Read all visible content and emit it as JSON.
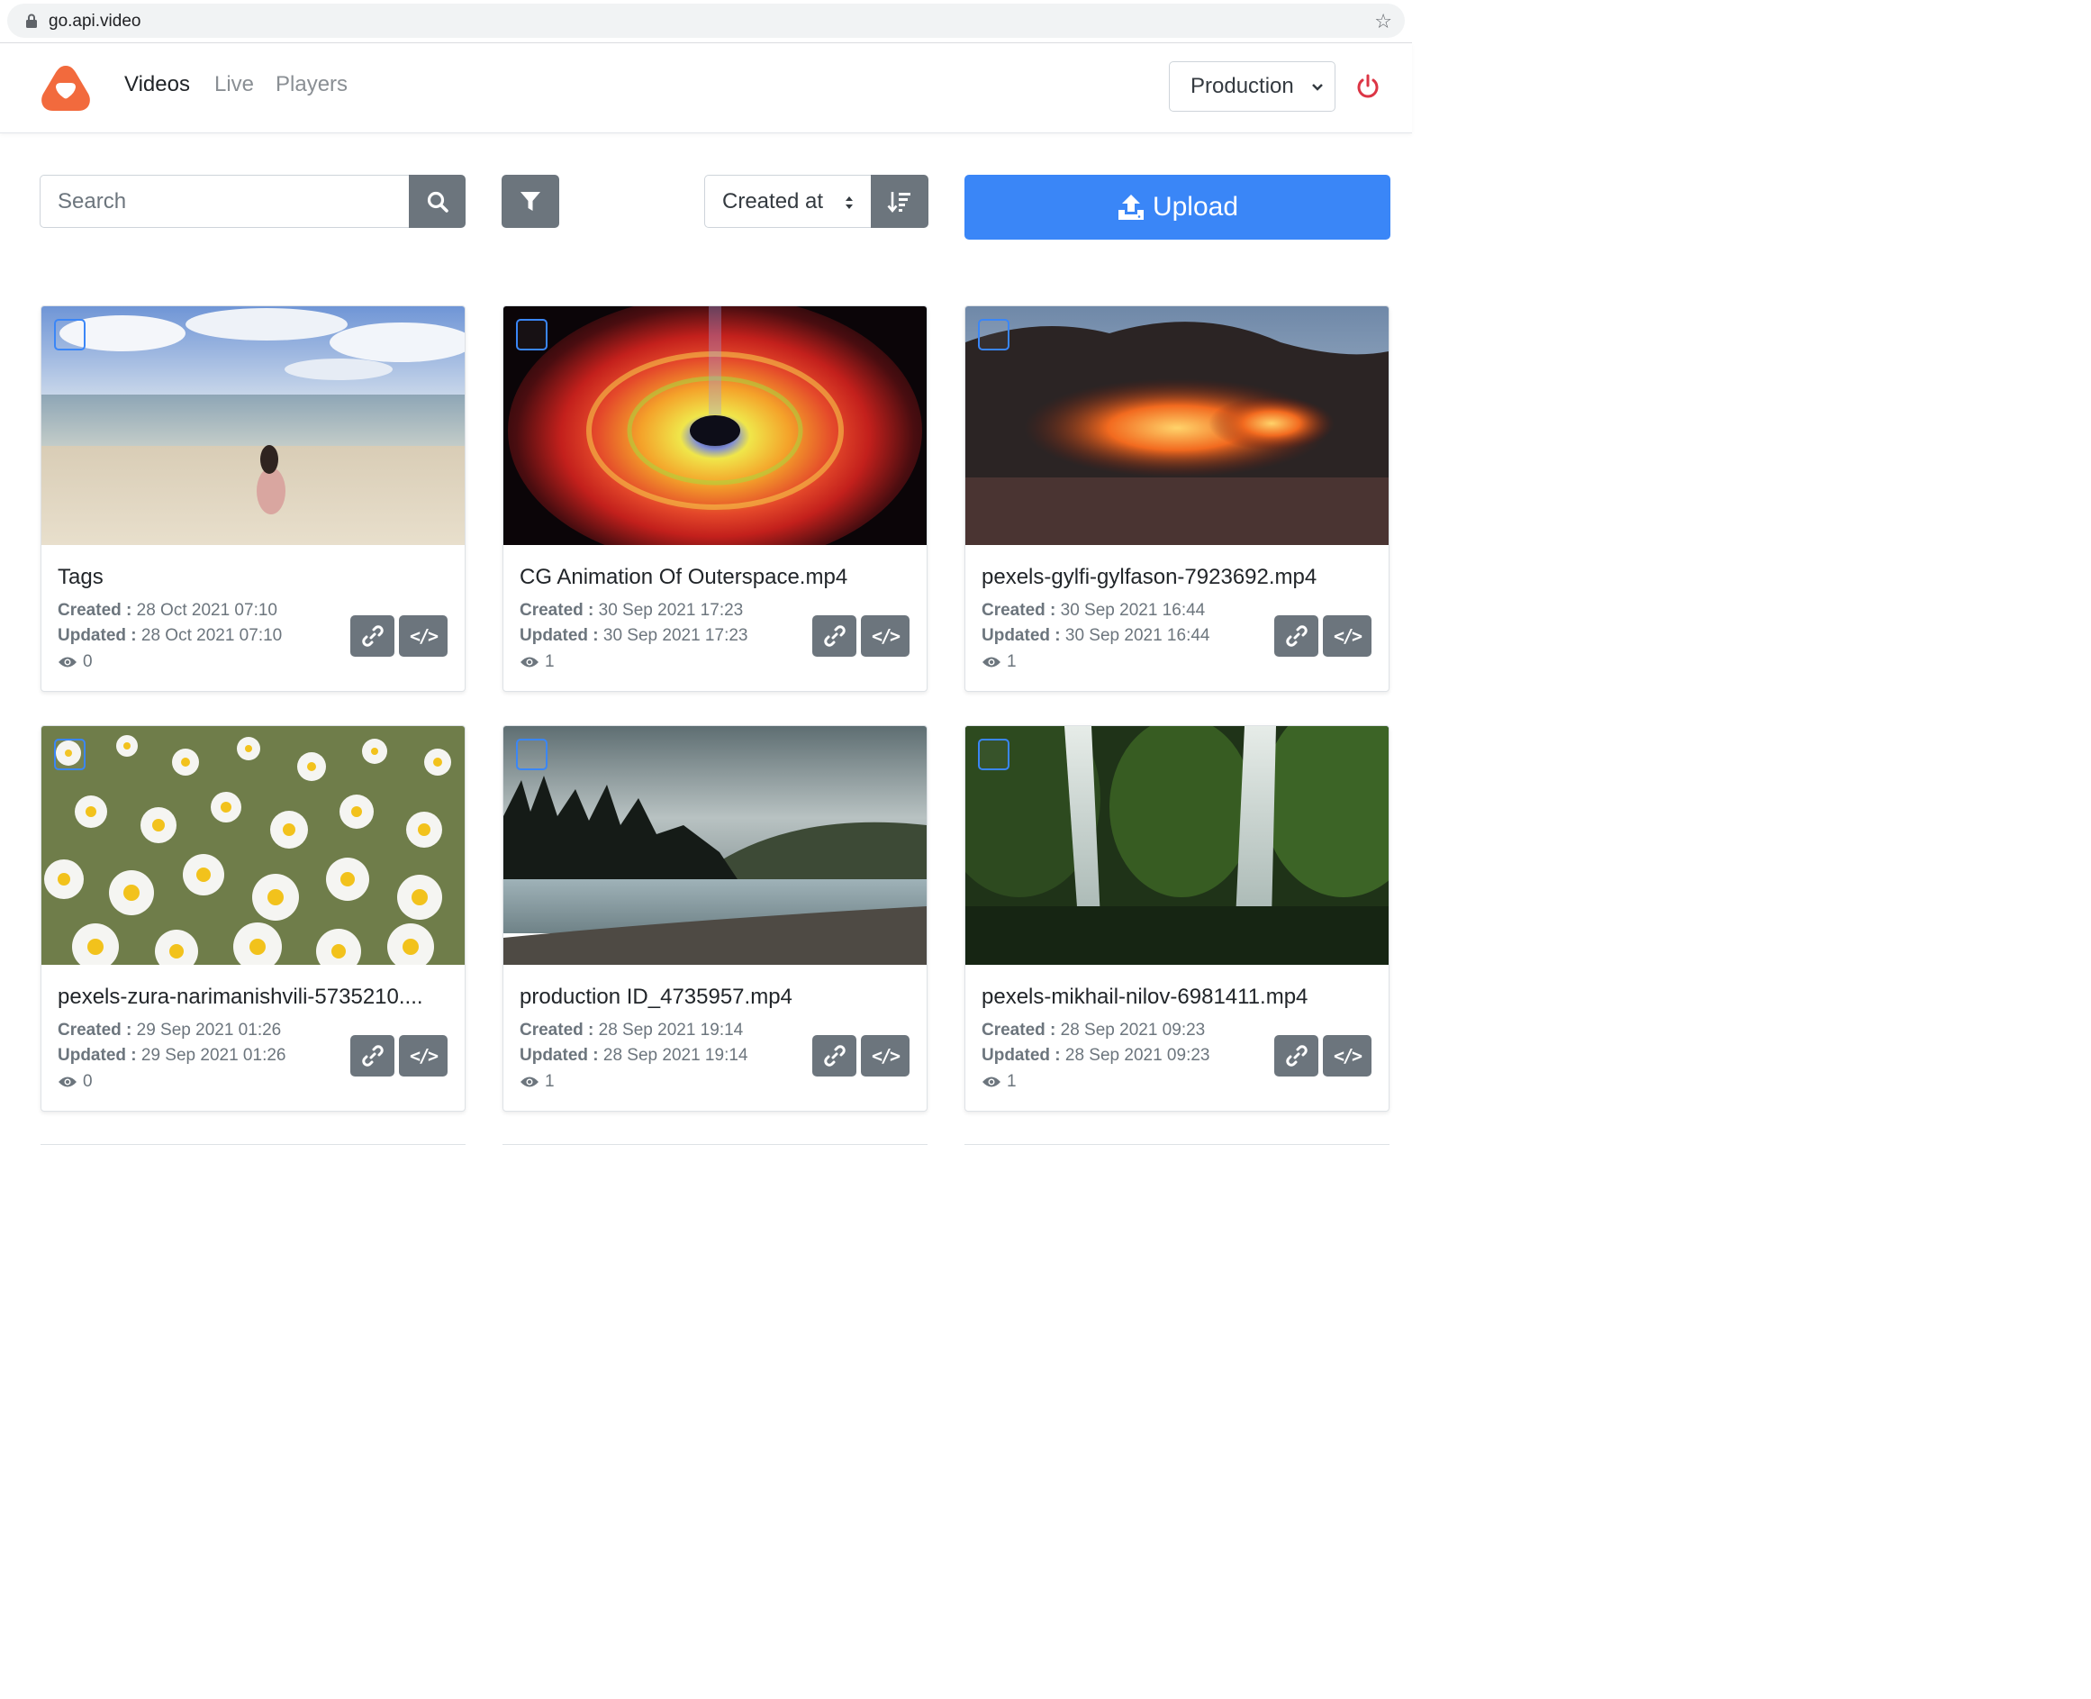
{
  "browser": {
    "url": "go.api.video"
  },
  "nav": {
    "links": [
      "Videos",
      "Live",
      "Players"
    ],
    "active": "Videos",
    "environment": "Production"
  },
  "toolbar": {
    "search_placeholder": "Search",
    "sort_label": "Created at",
    "upload_label": "Upload"
  },
  "labels": {
    "created": "Created :",
    "updated": "Updated :"
  },
  "colors": {
    "primary": "#3a86f7",
    "secondary": "#6c757d",
    "logo": "#f26a3d",
    "power": "#dc3545"
  },
  "videos": [
    {
      "title": "Tags",
      "created": "28 Oct 2021 07:10",
      "updated": "28 Oct 2021 07:10",
      "views": "0",
      "thumbnail": "beach"
    },
    {
      "title": "CG Animation Of Outerspace.mp4",
      "created": "30 Sep 2021 17:23",
      "updated": "30 Sep 2021 17:23",
      "views": "1",
      "thumbnail": "space-vortex"
    },
    {
      "title": "pexels-gylfi-gylfason-7923692.mp4",
      "created": "30 Sep 2021 16:44",
      "updated": "30 Sep 2021 16:44",
      "views": "1",
      "thumbnail": "lava"
    },
    {
      "title": "pexels-zura-narimanishvili-5735210....",
      "created": "29 Sep 2021 01:26",
      "updated": "29 Sep 2021 01:26",
      "views": "0",
      "thumbnail": "daisies"
    },
    {
      "title": "production ID_4735957.mp4",
      "created": "28 Sep 2021 19:14",
      "updated": "28 Sep 2021 19:14",
      "views": "1",
      "thumbnail": "river-forest"
    },
    {
      "title": "pexels-mikhail-nilov-6981411.mp4",
      "created": "28 Sep 2021 09:23",
      "updated": "28 Sep 2021 09:23",
      "views": "1",
      "thumbnail": "waterfall"
    }
  ]
}
